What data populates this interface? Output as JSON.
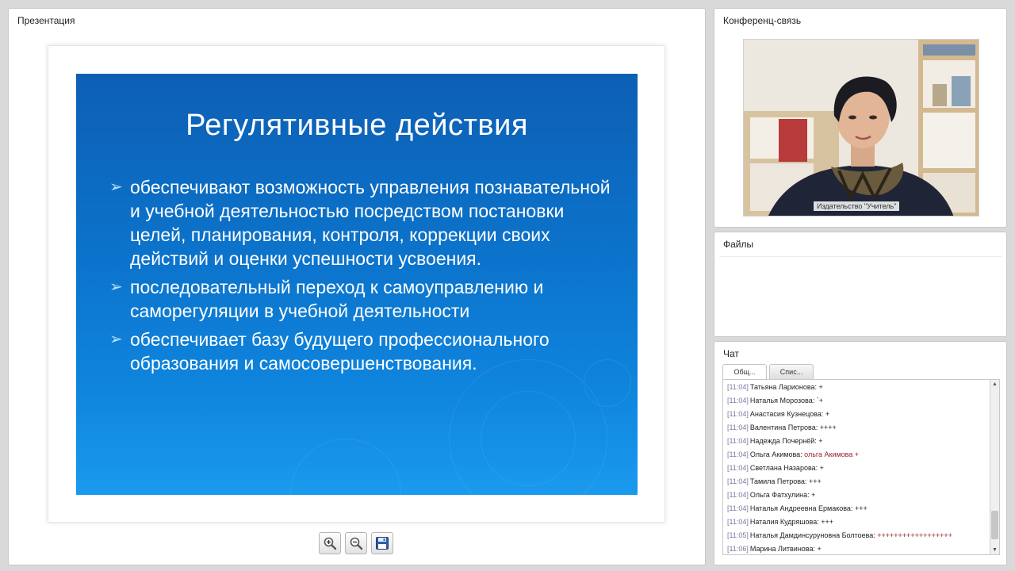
{
  "presentation": {
    "title": "Презентация",
    "slide": {
      "heading": "Регулятивные действия",
      "bullets": [
        "обеспечивают возможность управления познавательной и учебной деятельностью посредством постановки целей, планирования, контроля, коррекции своих действий и оценки успешности усвоения.",
        "последовательный переход к самоуправлению и саморегуляции в учебной деятельности",
        "обеспечивает базу будущего профессионального образования и самосовершенствования."
      ],
      "bullet_glyph": "➢",
      "background_color": "#0c74cc"
    },
    "toolbar": {
      "zoom_in_icon": "zoom-in-icon",
      "zoom_out_icon": "zoom-out-icon",
      "save_icon": "floppy-disk-icon"
    }
  },
  "conference": {
    "title": "Конференц-связь",
    "video_caption": "Издательство \"Учитель\""
  },
  "files": {
    "title": "Файлы"
  },
  "chat": {
    "title": "Чат",
    "tabs": [
      "Общ...",
      "Спис..."
    ],
    "active_tab": 0,
    "messages": [
      {
        "time": "[11:04]",
        "author": "Татьяна Ларионова:",
        "text": " +",
        "highlight": false
      },
      {
        "time": "[11:04]",
        "author": "Наталья Морозова:",
        "text": " `+",
        "highlight": false
      },
      {
        "time": "[11:04]",
        "author": "Анастасия Кузнецова:",
        "text": " +",
        "highlight": false
      },
      {
        "time": "[11:04]",
        "author": "Валентина Петрова:",
        "text": " ++++",
        "highlight": false
      },
      {
        "time": "[11:04]",
        "author": "Надежда Почернёй:",
        "text": " +",
        "highlight": false
      },
      {
        "time": "[11:04]",
        "author": "Ольга Акимова:",
        "text": " ольга Акимова +",
        "highlight": true
      },
      {
        "time": "[11:04]",
        "author": "Светлана Назарова:",
        "text": " +",
        "highlight": false
      },
      {
        "time": "[11:04]",
        "author": "Тамила Петрова:",
        "text": " +++",
        "highlight": false
      },
      {
        "time": "[11:04]",
        "author": "Ольга Фатхулина:",
        "text": " +",
        "highlight": false
      },
      {
        "time": "[11:04]",
        "author": "Наталья Андреевна Ермакова:",
        "text": " +++",
        "highlight": false
      },
      {
        "time": "[11:04]",
        "author": "Наталия Кудряшова:",
        "text": " +++",
        "highlight": false
      },
      {
        "time": "[11:05]",
        "author": "Наталья Дамдинсуруновна Болтоева:",
        "text": " ++++++++++++++++++",
        "highlight": true
      },
      {
        "time": "[11:06]",
        "author": "Марина Литвинова:",
        "text": " +",
        "highlight": false
      }
    ],
    "highlight_color": "#9b1f2c"
  }
}
